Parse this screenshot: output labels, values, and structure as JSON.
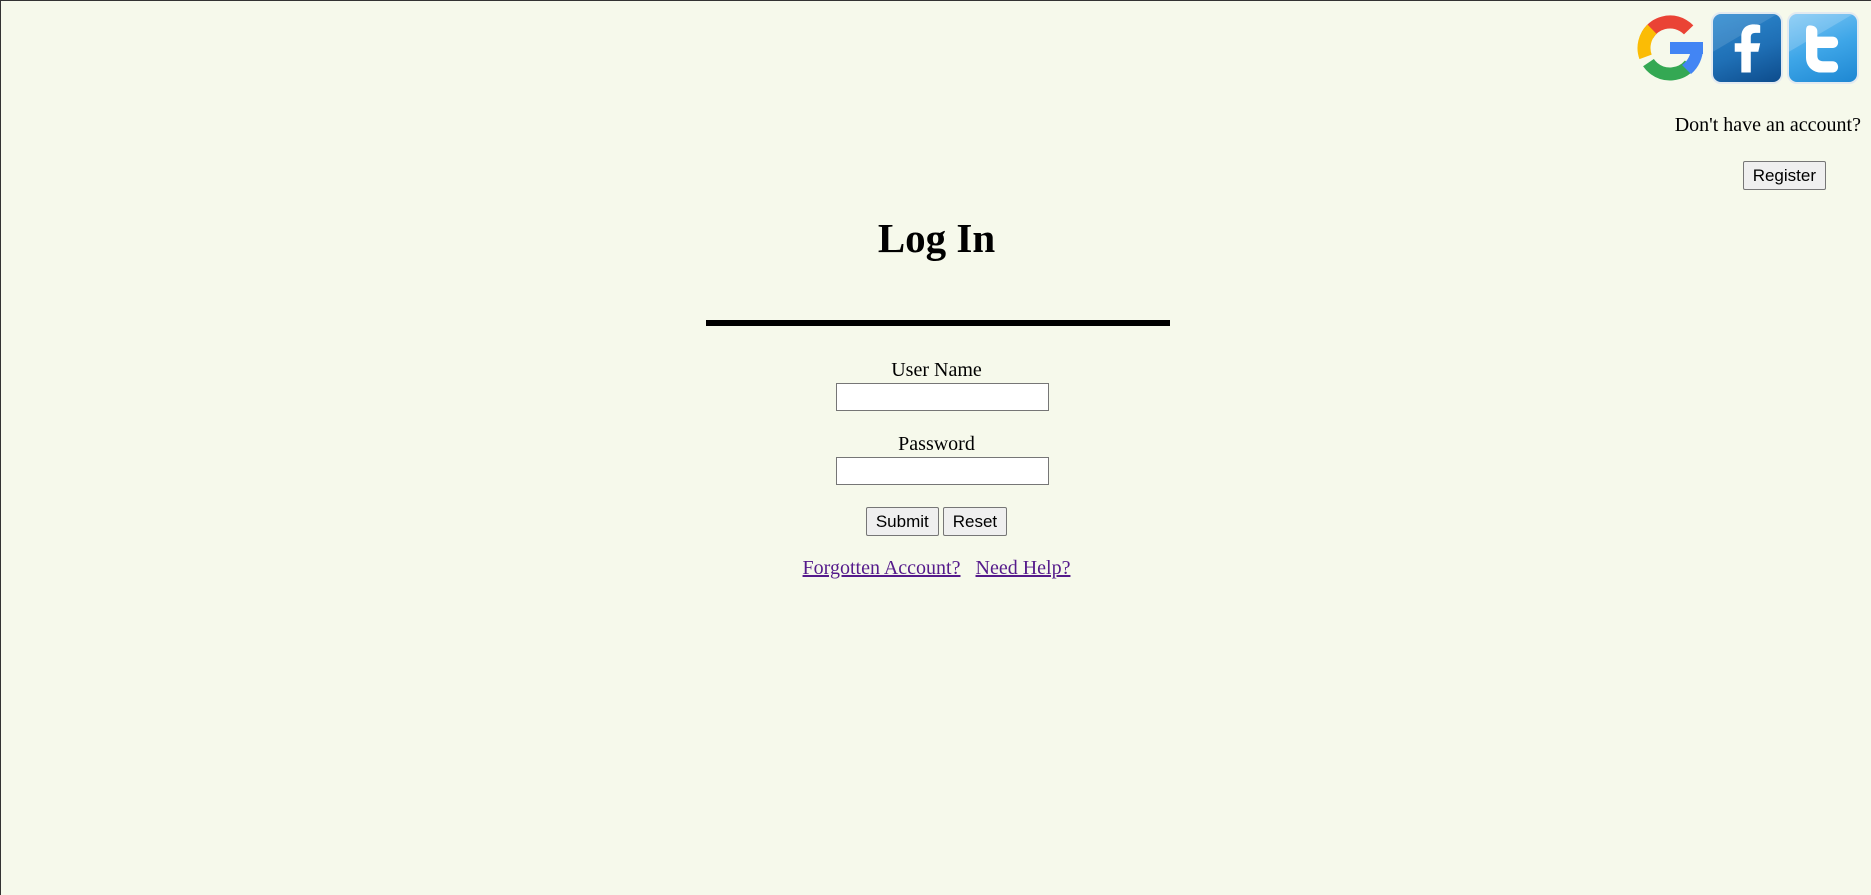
{
  "social": {
    "icons": [
      "google-icon",
      "facebook-icon",
      "twitter-icon"
    ],
    "google_colors": [
      "#ea4335",
      "#fbbc05",
      "#34a853",
      "#4285f4"
    ],
    "facebook_color": "#1f6fb5",
    "twitter_color": "#3ea6e8"
  },
  "account": {
    "prompt": "Don't have an account?",
    "register_label": "Register"
  },
  "login": {
    "title": "Log In",
    "username_label": "User Name",
    "username_value": "",
    "password_label": "Password",
    "password_value": "",
    "submit_label": "Submit",
    "reset_label": "Reset",
    "forgot_link": "Forgotten Account?",
    "help_link": "Need Help?"
  },
  "colors": {
    "background": "#f6f9eb",
    "visited_link": "#551a8b"
  }
}
